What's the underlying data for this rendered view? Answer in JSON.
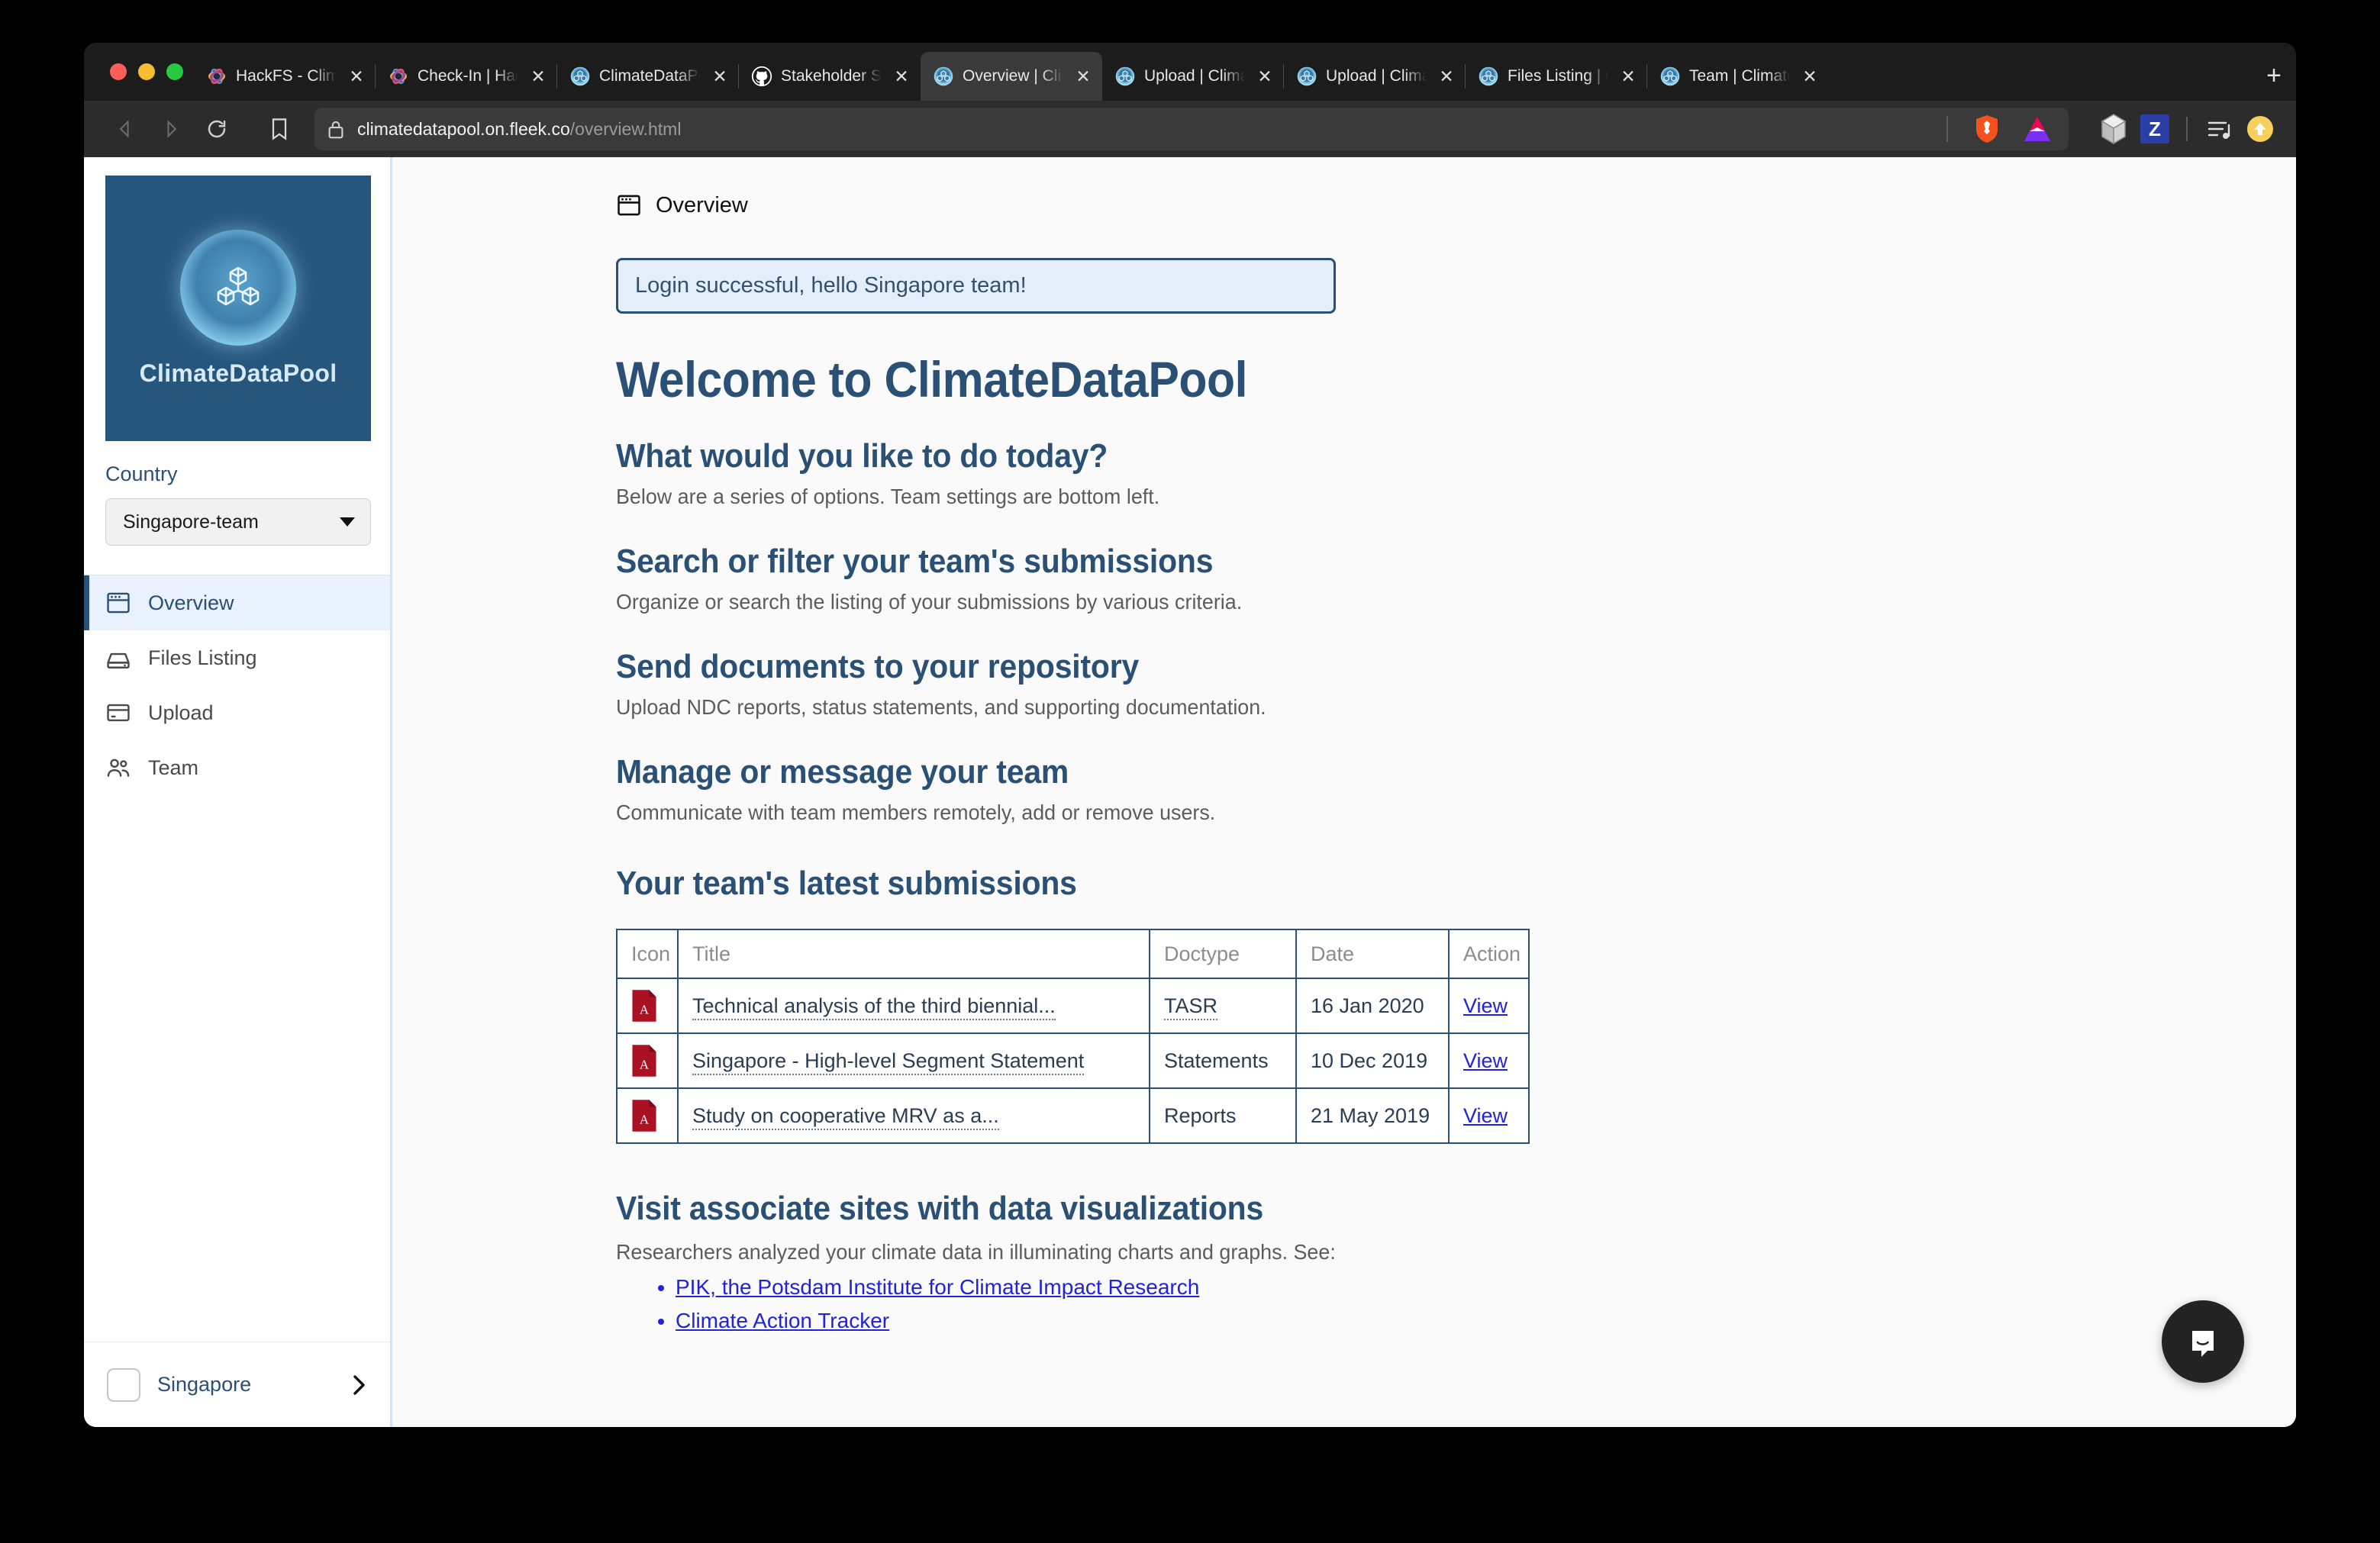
{
  "browser": {
    "tabs": [
      {
        "title": "HackFS - Clima",
        "favicon": "hackfs-icon",
        "active": false
      },
      {
        "title": "Check-In | Hack",
        "favicon": "hackfs-icon",
        "active": false
      },
      {
        "title": "ClimateDataPoo",
        "favicon": "climatedatapool-icon",
        "active": false
      },
      {
        "title": "Stakeholder Sta",
        "favicon": "github-icon",
        "active": false
      },
      {
        "title": "Overview | Clim",
        "favicon": "climatedatapool-icon",
        "active": true
      },
      {
        "title": "Upload | Climat",
        "favicon": "climatedatapool-icon",
        "active": false
      },
      {
        "title": "Upload | Climat",
        "favicon": "climatedatapool-icon",
        "active": false
      },
      {
        "title": "Files Listing | C",
        "favicon": "climatedatapool-icon",
        "active": false
      },
      {
        "title": "Team | ClimateD",
        "favicon": "climatedatapool-icon",
        "active": false
      }
    ],
    "new_tab_label": "+",
    "tab_close_label": "✕",
    "url_domain": "climatedatapool.on.fleek.co",
    "url_path": "/overview.html",
    "extensions": [
      "brave-shields-icon",
      "brave-rewards-icon",
      "ipfs-cube-icon",
      "zotero-icon",
      "playlist-icon",
      "profile-avatar-icon"
    ]
  },
  "sidebar": {
    "logo_text": "ClimateDataPool",
    "country_label": "Country",
    "country_value": "Singapore-team",
    "nav_items": [
      {
        "label": "Overview",
        "icon": "window-icon",
        "active": true
      },
      {
        "label": "Files Listing",
        "icon": "drive-icon",
        "active": false
      },
      {
        "label": "Upload",
        "icon": "card-icon",
        "active": false
      },
      {
        "label": "Team",
        "icon": "users-icon",
        "active": false
      }
    ],
    "footer_label": "Singapore",
    "footer_chevron": "›"
  },
  "page": {
    "crumb": "Overview",
    "crumb_icon": "window-icon",
    "alert": "Login successful, hello Singapore team!",
    "title": "Welcome to ClimateDataPool",
    "sections": [
      {
        "heading": "What would you like to do today?",
        "desc": "Below are a series of options. Team settings are bottom left."
      },
      {
        "heading": "Search or filter your team's submissions",
        "desc": "Organize or search the listing of your submissions by various criteria."
      },
      {
        "heading": "Send documents to your repository",
        "desc": "Upload NDC reports, status statements, and supporting documentation."
      },
      {
        "heading": "Manage or message your team",
        "desc": "Communicate with team members remotely, add or remove users."
      }
    ],
    "table": {
      "title": "Your team's latest submissions",
      "headers": [
        "Icon",
        "Title",
        "Doctype",
        "Date",
        "Action"
      ],
      "rows": [
        {
          "icon": "pdf-icon",
          "title": "Technical analysis of the third biennial...",
          "doctype": "TASR",
          "doctype_link": true,
          "date": "16 Jan 2020",
          "action": "View"
        },
        {
          "icon": "pdf-icon",
          "title": "Singapore - High-level Segment Statement",
          "doctype": "Statements",
          "doctype_link": false,
          "date": "10 Dec 2019",
          "action": "View"
        },
        {
          "icon": "pdf-icon",
          "title": "Study on cooperative MRV as a...",
          "doctype": "Reports",
          "doctype_link": false,
          "date": "21 May 2019",
          "action": "View"
        }
      ]
    },
    "associates": {
      "title": "Visit associate sites with data visualizations",
      "desc": "Researchers analyzed your climate data in illuminating charts and graphs. See:",
      "links": [
        "PIK, the Potsdam Institute for Climate Impact Research",
        "Climate Action Tracker"
      ]
    },
    "chat_widget": "intercom-messenger-icon"
  },
  "colors": {
    "brand_navy": "#2b5075",
    "logo_bg": "#27567d",
    "alert_bg": "#e3eefa",
    "link_blue": "#2222dd",
    "pdf_red": "#aa1122",
    "sidebar_border": "#cfe2f7"
  }
}
